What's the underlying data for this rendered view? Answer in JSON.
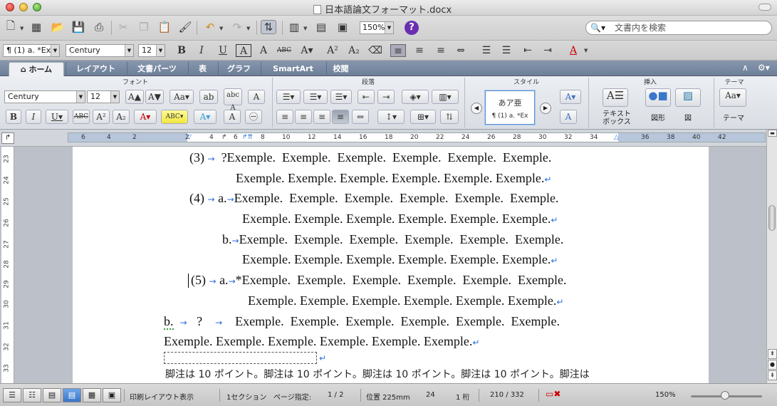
{
  "window": {
    "title": "日本語論文フォーマット.docx"
  },
  "toolbar": {
    "zoom": "150%",
    "search_placeholder": "文書内を検索",
    "help": "?"
  },
  "format_bar": {
    "style": "¶ (1) a. *Ex",
    "font": "Century",
    "size": "12",
    "bold": "B",
    "italic": "I",
    "underline": "U"
  },
  "ribbon_tabs": [
    "ホーム",
    "レイアウト",
    "文書パーツ",
    "表",
    "グラフ",
    "SmartArt",
    "校閲"
  ],
  "ribbon": {
    "groups": {
      "font": "フォント",
      "paragraph": "段落",
      "style": "スタイル",
      "insert": "挿入",
      "theme": "テーマ"
    },
    "font_name": "Century",
    "font_size": "12",
    "style_preview": "あア亜",
    "style_name": "¶ (1) a. *Ex",
    "textbox_label": "テキスト\nボックス",
    "shape_label": "図形",
    "picture_label": "図",
    "theme_label": "テーマ"
  },
  "ruler": {
    "ticks": [
      "6",
      "4",
      "2",
      "2",
      "4",
      "6",
      "8",
      "10",
      "12",
      "14",
      "16",
      "18",
      "20",
      "22",
      "24",
      "26",
      "28",
      "30",
      "32",
      "34",
      "36",
      "38",
      "40",
      "42"
    ]
  },
  "vertical_ruler": [
    "23",
    "24",
    "25",
    "26",
    "27",
    "28",
    "29",
    "30",
    "31",
    "32",
    "33"
  ],
  "document": {
    "line1": {
      "num": "(3)",
      "text": "?Exemple.  Exemple.  Exemple.  Exemple.  Exemple.  Exemple."
    },
    "line2": "Exemple. Exemple. Exemple. Exemple. Exemple. Exemple.",
    "line3": {
      "num": "(4)",
      "sub": "a.",
      "text": "Exemple.  Exemple.  Exemple.  Exemple.  Exemple.  Exemple."
    },
    "line4": "Exemple. Exemple. Exemple. Exemple. Exemple. Exemple.",
    "line5": {
      "sub": "b.",
      "text": "Exemple.  Exemple.  Exemple.  Exemple.  Exemple.  Exemple."
    },
    "line6": "Exemple. Exemple. Exemple. Exemple. Exemple. Exemple.",
    "line7": {
      "num": "(5)",
      "sub": "a.",
      "text": "*Exemple.  Exemple.  Exemple.  Exemple.  Exemple.  Exemple."
    },
    "line8": "Exemple. Exemple. Exemple. Exemple. Exemple. Exemple.",
    "line9": {
      "sub": "b.",
      "mark": "?",
      "text": "Exemple.  Exemple.  Exemple.  Exemple.  Exemple.  Exemple."
    },
    "line10": "Exemple. Exemple. Exemple. Exemple. Exemple. Exemple.",
    "footnote": "脚注は 10 ポイント。脚注は 10 ポイント。脚注は 10 ポイント。脚注は 10 ポイント。脚注は"
  },
  "status": {
    "view": "印刷レイアウト表示",
    "section": "1セクション",
    "page_label": "ページ指定:",
    "page": "1 / 2",
    "position": "位置 225mm",
    "line": "24",
    "column": "1 桁",
    "words": "210 / 332",
    "zoom": "150%"
  },
  "colors": {
    "tab_bar": "#7d8ca3",
    "accent": "#2a6edc",
    "help": "#6a2fb0"
  }
}
